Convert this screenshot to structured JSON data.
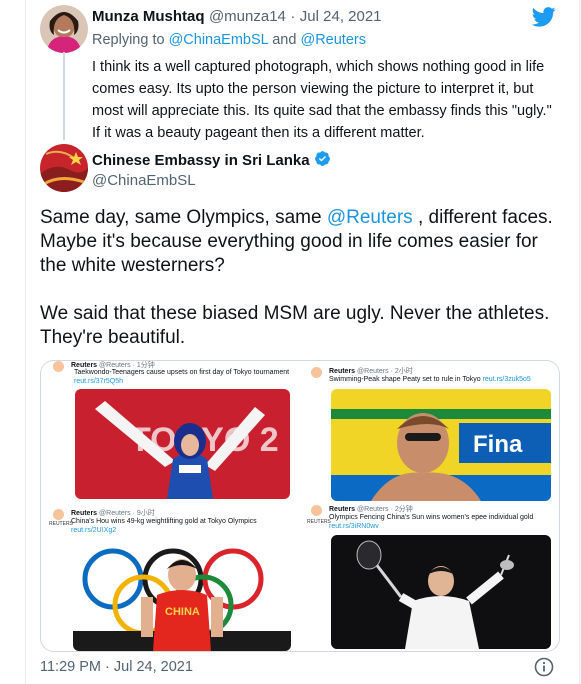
{
  "reply": {
    "name": "Munza Mushtaq",
    "handle": "@munza14",
    "separator": "·",
    "date": "Jul 24, 2021",
    "replying_prefix": "Replying to",
    "reply_to_1": "@ChinaEmbSL",
    "reply_and": "and",
    "reply_to_2": "@Reuters",
    "text": "I think its a well captured photograph, which shows nothing good in life comes easy. Its upto the person viewing the picture to interpret it, but most will appreciate this. Its quite sad that the embassy finds this \"ugly.\" If it was a beauty pageant then its a different matter."
  },
  "main": {
    "name": "Chinese Embassy in Sri Lanka",
    "handle": "@ChinaEmbSL",
    "text_pre": "Same day, same Olympics, same ",
    "text_mention": "@Reuters",
    "text_post": " , different faces. Maybe it's because everything good in life comes easier for the white westerners?",
    "text_p2": "We said that these biased MSM are ugly. Never the athletes. They're beautiful.",
    "timestamp": "11:29 PM · Jul 24, 2021"
  },
  "media": {
    "panels": [
      {
        "label": "REUTERS",
        "name": "Reuters",
        "meta": "@Reuters · 1分钟",
        "text": "Taekwondo-Teenagers cause upsets on first day of Tokyo tournament",
        "link": "reut.rs/37r5Q5h",
        "photo_text": "TOKYO 2"
      },
      {
        "label": "REUTERS",
        "name": "Reuters",
        "meta": "@Reuters · 2小时",
        "text": "Swimming-Peak shape Peaty set to rule in Tokyo",
        "link": "reut.rs/3zuk5o5",
        "photo_text": "Fina"
      },
      {
        "label": "REUTERS",
        "name": "Reuters",
        "meta": "@Reuters · 9小时",
        "text": "China's Hou wins 49-kg weightlifting gold at Tokyo Olympics",
        "link": "reut.rs/2UIXg2",
        "photo_text": "CHINA"
      },
      {
        "label": "REUTERS",
        "name": "Reuters",
        "meta": "@Reuters · 2分钟",
        "text": "Olympics Fencing China's Sun wins women's epee individual gold",
        "link": "reut.rs/3iRN0wv",
        "photo_text": ""
      }
    ]
  },
  "colors": {
    "link": "#1b95e0",
    "verified": "#1d9bf0",
    "twitter": "#1d9bf0"
  },
  "icons": {
    "twitter": "twitter-bird-icon",
    "verified": "verified-badge-icon",
    "info": "info-icon"
  }
}
